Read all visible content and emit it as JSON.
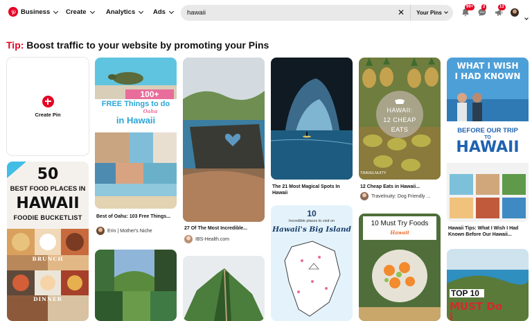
{
  "nav": {
    "business": "Business",
    "create": "Create",
    "analytics": "Analytics",
    "ads": "Ads"
  },
  "search": {
    "query": "hawaii",
    "clear": "✕",
    "scope": "Your Pins"
  },
  "badges": {
    "notifications": "99+",
    "messages": "2",
    "updates": "13"
  },
  "tip": {
    "prefix": "Tip:",
    "text": " Boost traffic to your website by promoting your Pins"
  },
  "create_pin": "Create Pin",
  "pins": {
    "p1": {
      "title": "Best of Oahu: 103 Free Things...",
      "source": "Erin | Mother's Niche",
      "overlay": {
        "line1": "100+",
        "line2": "FREE Things to do",
        "line3": "Oahu",
        "line4": "in Hawaii"
      }
    },
    "p2": {
      "title": "27 Of The Most Incredible...",
      "source": "IBS-Health.com"
    },
    "p3": {
      "title": "The 21 Most Magical Spots In Hawaii"
    },
    "p4": {
      "title": "12 Cheap Eats in Hawaii...",
      "source": "Travelnuity: Dog Friendly ...",
      "overlay": {
        "line1": "HAWAII:",
        "line2": "12 CHEAP",
        "line3": "EATS",
        "watermark": "TRAVELNUITY"
      }
    },
    "p5": {
      "title": "Hawaii Tips: What I Wish I Had Known Before Our Hawaii...",
      "overlay": {
        "line1": "WHAT I WISH",
        "line2": "I HAD KNOWN",
        "line3": "BEFORE OUR TRIP",
        "line4": "TO",
        "line5": "HAWAII"
      }
    },
    "p6": {
      "overlay": {
        "line1": "50",
        "line2": "BEST FOOD PLACES IN",
        "line3": "HAWAII",
        "line4": "FOODIE BUCKETLIST",
        "line5": "BRUNCH",
        "line6": "DINNER"
      }
    },
    "p7": {
      "overlay": {
        "line1": "10",
        "line2": "Incredible places to visit on",
        "line3": "Hawaii's Big Island"
      }
    },
    "p8": {
      "overlay": {
        "line1": "10 Must Try Foods",
        "line2": "Hawaii"
      }
    },
    "p9": {
      "overlay": {
        "line1": "TOP 10",
        "line2": "MUST Do i"
      }
    }
  }
}
